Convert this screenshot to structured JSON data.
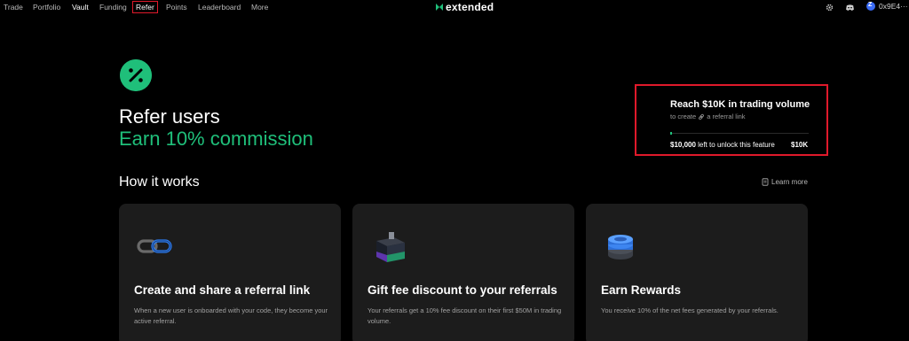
{
  "nav": {
    "items": [
      "Trade",
      "Portfolio",
      "Vault",
      "Funding",
      "Refer",
      "Points",
      "Leaderboard",
      "More"
    ],
    "logo_text": "extended",
    "wallet_address": "0x9E4···"
  },
  "hero": {
    "title": "Refer users",
    "subtitle": "Earn 10% commission"
  },
  "progress": {
    "title": "Reach $10K in trading volume",
    "subtitle_prefix": "to create",
    "subtitle_suffix": "a referral link",
    "left_amount": "$10,000",
    "left_text": "left to unlock this feature",
    "target": "$10K",
    "fraction_complete": 0.01
  },
  "how": {
    "title": "How it works",
    "learn_more": "Learn more"
  },
  "cards": [
    {
      "title": "Create and share a referral link",
      "desc": "When a new user is onboarded with your code, they become your active referral."
    },
    {
      "title": "Gift fee discount to your referrals",
      "desc": "Your referrals get a 10% fee discount on their first $50M in trading volume."
    },
    {
      "title": "Earn Rewards",
      "desc": "You receive 10% of the net fees generated by your referrals."
    }
  ],
  "colors": {
    "accent": "#1fbf7a",
    "highlight": "#e0192b",
    "card_bg": "#1c1c1c",
    "bg": "#000000"
  }
}
